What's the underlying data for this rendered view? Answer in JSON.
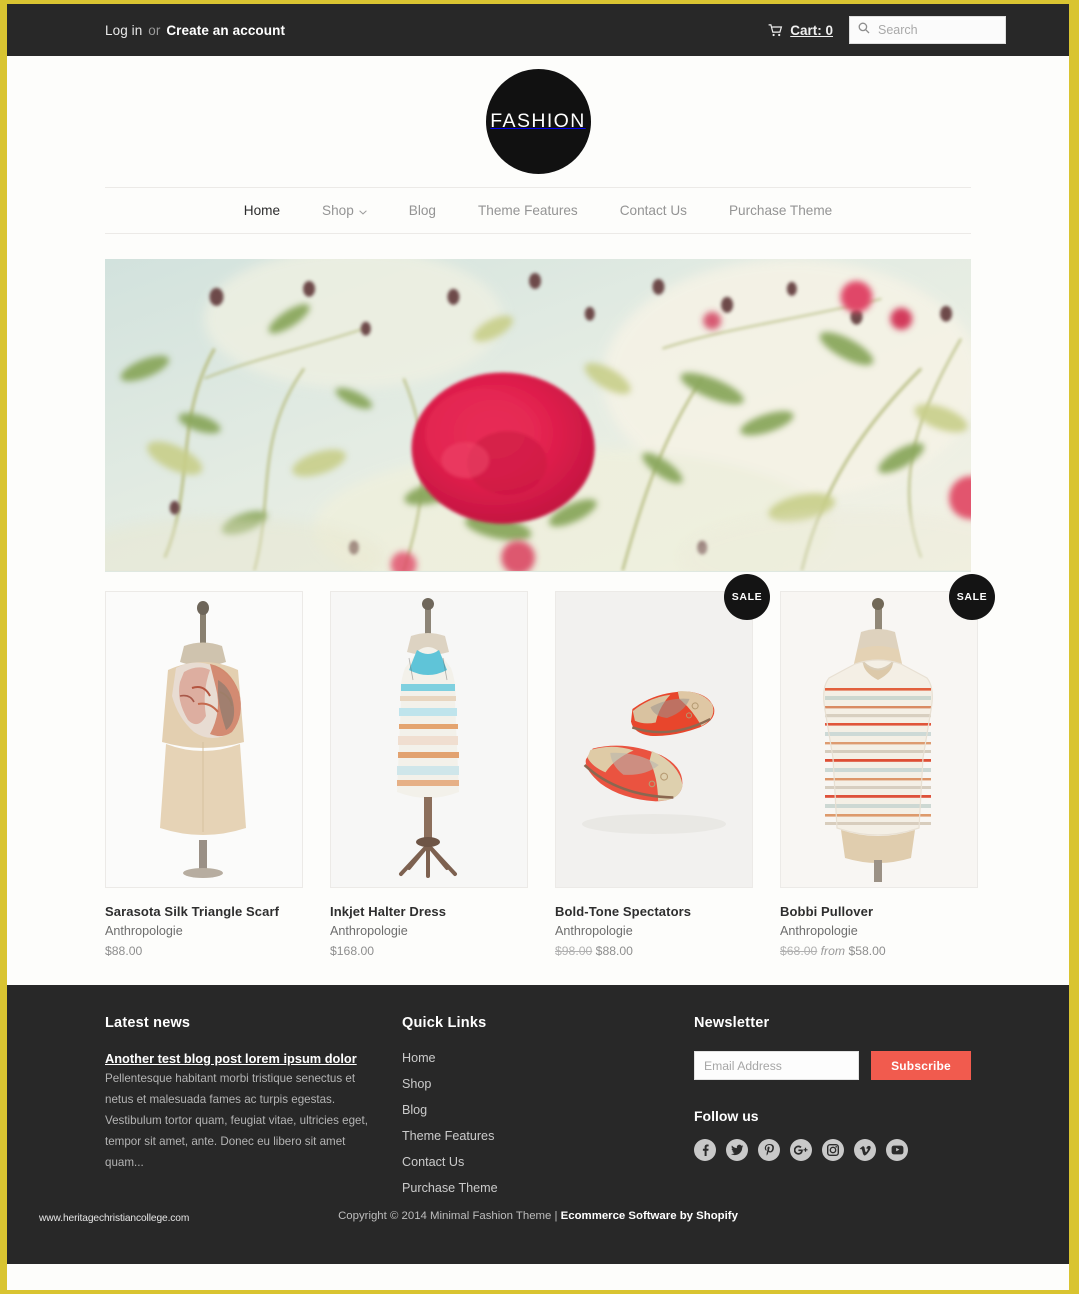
{
  "topbar": {
    "login_label": "Log in",
    "or_label": "or",
    "create_account_label": "Create an account",
    "cart_label": "Cart: 0",
    "cart_icon": "shopping-cart-icon",
    "search_icon": "search-icon",
    "search_placeholder": "Search",
    "search_value": ""
  },
  "logo": {
    "text": "FASHION"
  },
  "nav": {
    "items": [
      {
        "label": "Home",
        "active": true,
        "has_caret": false
      },
      {
        "label": "Shop",
        "active": false,
        "has_caret": true
      },
      {
        "label": "Blog",
        "active": false,
        "has_caret": false
      },
      {
        "label": "Theme Features",
        "active": false,
        "has_caret": false
      },
      {
        "label": "Contact Us",
        "active": false,
        "has_caret": false
      },
      {
        "label": "Purchase Theme",
        "active": false,
        "has_caret": false
      }
    ]
  },
  "hero": {
    "alt": "pink roses and foliage against pale sky"
  },
  "products": [
    {
      "title": "Sarasota Silk Triangle Scarf",
      "vendor": "Anthropologie",
      "price": "$88.00",
      "old_price": "",
      "from_label": "",
      "on_sale": false,
      "sale_label": ""
    },
    {
      "title": "Inkjet Halter Dress",
      "vendor": "Anthropologie",
      "price": "$168.00",
      "old_price": "",
      "from_label": "",
      "on_sale": false,
      "sale_label": ""
    },
    {
      "title": "Bold-Tone Spectators",
      "vendor": "Anthropologie",
      "price": "$88.00",
      "old_price": "$98.00",
      "from_label": "",
      "on_sale": true,
      "sale_label": "SALE"
    },
    {
      "title": "Bobbi Pullover",
      "vendor": "Anthropologie",
      "price": "$58.00",
      "old_price": "$68.00",
      "from_label": "from",
      "on_sale": true,
      "sale_label": "SALE"
    }
  ],
  "footer": {
    "news_heading": "Latest news",
    "news_post_title": "Another test blog post lorem ipsum dolor",
    "news_body": "Pellentesque habitant morbi tristique senectus et netus et malesuada fames ac turpis egestas. Vestibulum tortor quam, feugiat vitae, ultricies eget, tempor sit amet, ante. Donec eu libero sit amet quam...",
    "quick_links_heading": "Quick Links",
    "quick_links": [
      "Home",
      "Shop",
      "Blog",
      "Theme Features",
      "Contact Us",
      "Purchase Theme"
    ],
    "newsletter_heading": "Newsletter",
    "newsletter_placeholder": "Email Address",
    "newsletter_value": "",
    "subscribe_label": "Subscribe",
    "follow_heading": "Follow us",
    "socials": [
      "facebook-icon",
      "twitter-icon",
      "pinterest-icon",
      "google-plus-icon",
      "instagram-icon",
      "vimeo-icon",
      "youtube-icon"
    ],
    "copyright_prefix": "Copyright © 2014 Minimal Fashion Theme |",
    "copyright_link": "Ecommerce Software by Shopify",
    "watermark": "www.heritagechristiancollege.com"
  },
  "colors": {
    "frame": "#d9c431",
    "dark": "#282828",
    "accent": "#f15b4e",
    "page_bg": "#fdfdfb"
  }
}
